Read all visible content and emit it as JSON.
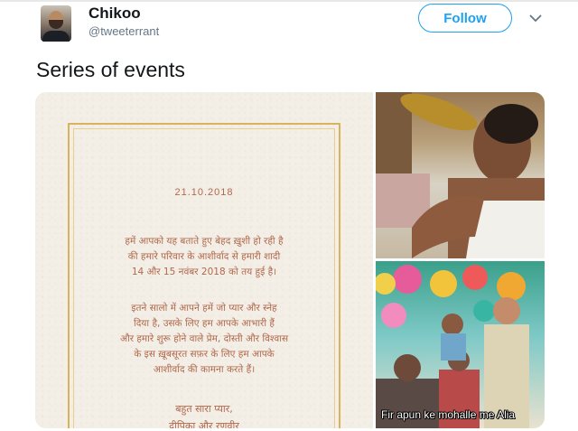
{
  "tweet": {
    "author_name": "Chikoo",
    "author_handle": "@tweeterrant",
    "follow_label": "Follow",
    "text": "Series of events"
  },
  "invitation": {
    "date": "21.10.2018",
    "paragraph1": "हमें आपको यह बताते हुए बेहद ख़ुशी हो रही है\nकी हमारे परिवार के आशीर्वाद से हमारी शादी\n14 और 15 नवंबर 2018 को तय हुई है।",
    "paragraph2": "इतने सालो में आपने हमें जो प्यार और स्नेह\nदिया है, उसके लिए हम आपके आभारी हैं\nऔर हमारे शुरू होने वाले प्रेम, दोस्ती और विश्वास\nके इस ख़ूबसूरत सफ़र के लिए हम आपके\nआशीर्वाद की कामना करते हैं।",
    "signoff": "बहुत सारा प्यार,\nदीपिका और रणवीर"
  },
  "meme": {
    "caption": "Fir apun ke mohalle me Alia"
  },
  "colors": {
    "accent": "#1da1f2",
    "invitation_text": "#b0684b",
    "gold_border": "#d9b25d"
  },
  "icons": {
    "dropdown": "chevron-down-icon"
  }
}
